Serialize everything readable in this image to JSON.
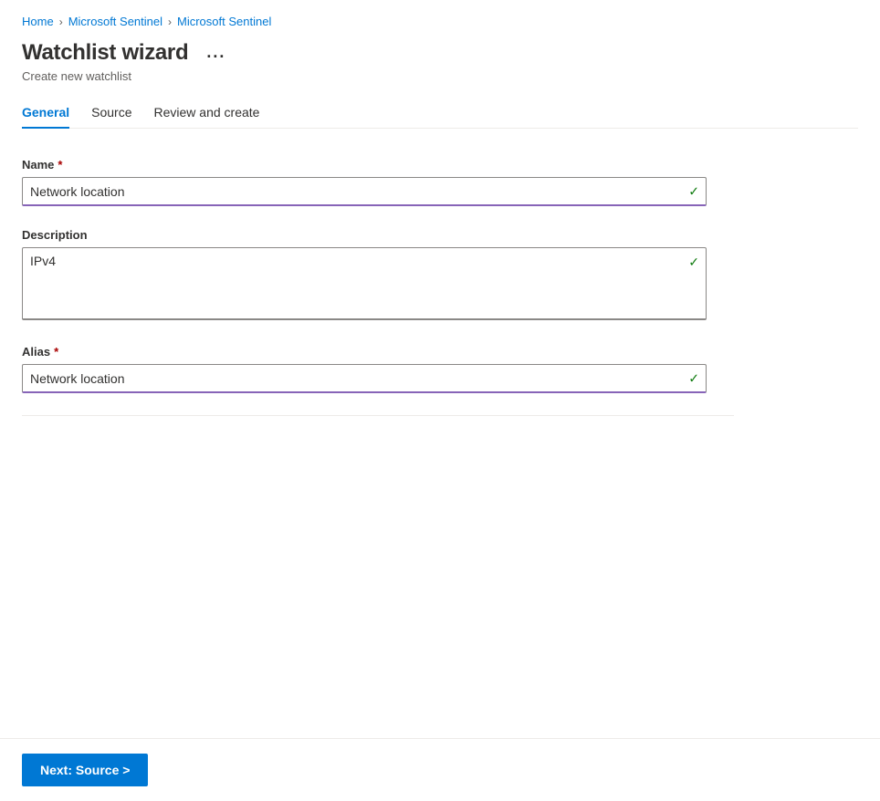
{
  "breadcrumb": {
    "items": [
      {
        "label": "Home",
        "link": true
      },
      {
        "label": "Microsoft Sentinel",
        "link": true
      },
      {
        "label": "Microsoft Sentinel",
        "link": true
      }
    ],
    "separators": [
      ">",
      ">"
    ]
  },
  "header": {
    "title": "Watchlist wizard",
    "subtitle": "Create new watchlist",
    "more_options_label": "..."
  },
  "tabs": [
    {
      "label": "General",
      "active": true
    },
    {
      "label": "Source",
      "active": false
    },
    {
      "label": "Review and create",
      "active": false
    }
  ],
  "form": {
    "name": {
      "label": "Name",
      "required": true,
      "value": "Network location",
      "check": "✓"
    },
    "description": {
      "label": "Description",
      "required": false,
      "value": "IPv4",
      "check": "✓"
    },
    "alias": {
      "label": "Alias",
      "required": true,
      "value": "Network location",
      "check": "✓"
    }
  },
  "footer": {
    "next_button_label": "Next: Source >"
  },
  "icons": {
    "required_star": "*",
    "check": "✓",
    "breadcrumb_sep": "›"
  }
}
